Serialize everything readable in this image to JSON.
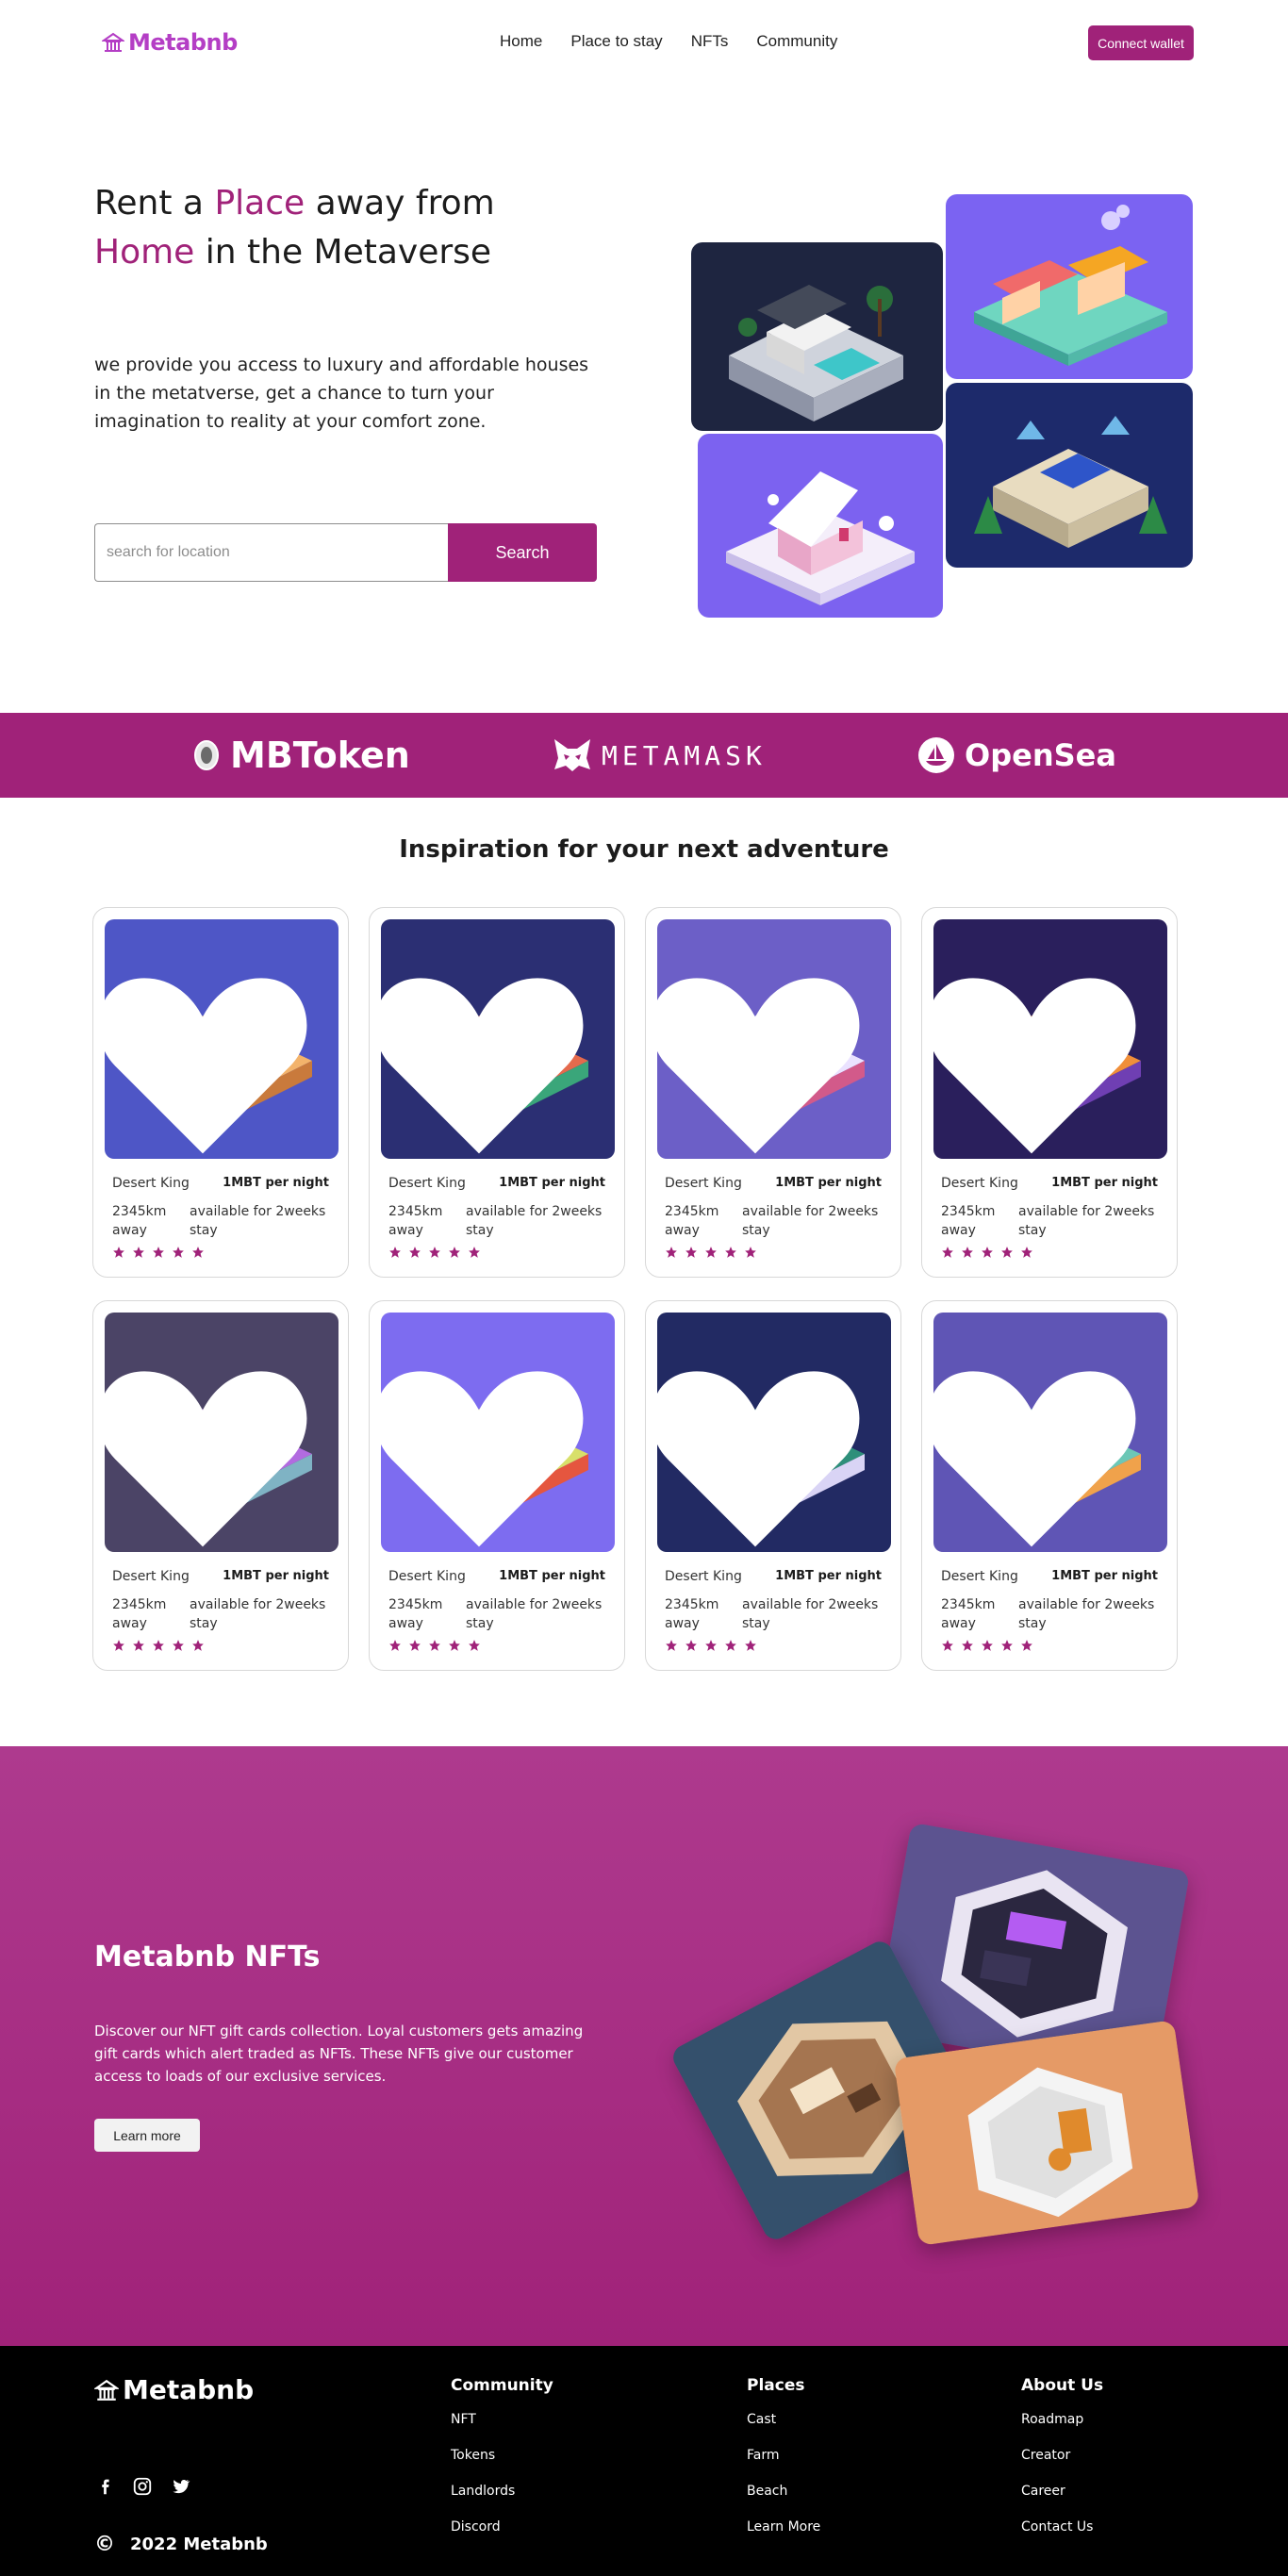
{
  "brand": {
    "name": "Metabnb",
    "logo_icon": "house-icon",
    "accent_color": "#a02279",
    "logo_color": "#b43ec5"
  },
  "nav": {
    "links": [
      "Home",
      "Place to stay",
      "NFTs",
      "Community"
    ],
    "connect_label": "Connect wallet"
  },
  "hero": {
    "title_part1": "Rent a ",
    "title_accent1": "Place",
    "title_part2": " away from",
    "title_accent2": "Home",
    "title_part3": " in the Metaverse",
    "description": "we provide you access to luxury and affordable houses in the metatverse, get a chance to turn your imagination to reality at your comfort zone.",
    "search_placeholder": "search for location",
    "search_value": "",
    "search_button": "Search"
  },
  "partners": [
    {
      "name": "MBToken",
      "icon": "mbtoken-coin-icon"
    },
    {
      "name": "METAMASK",
      "icon": "metamask-fox-icon"
    },
    {
      "name": "OpenSea",
      "icon": "opensea-boat-icon"
    }
  ],
  "inspiration": {
    "title": "Inspiration for your next adventure",
    "cards": [
      {
        "name": "Desert King",
        "price": "1MBT per night",
        "distance": "2345km away",
        "availability": "available for 2weeks stay",
        "rating": 5
      },
      {
        "name": "Desert King",
        "price": "1MBT per night",
        "distance": "2345km away",
        "availability": "available for 2weeks stay",
        "rating": 5
      },
      {
        "name": "Desert King",
        "price": "1MBT per night",
        "distance": "2345km away",
        "availability": "available for 2weeks stay",
        "rating": 5
      },
      {
        "name": "Desert King",
        "price": "1MBT per night",
        "distance": "2345km away",
        "availability": "available for 2weeks stay",
        "rating": 5
      },
      {
        "name": "Desert King",
        "price": "1MBT per night",
        "distance": "2345km away",
        "availability": "available for 2weeks stay",
        "rating": 5
      },
      {
        "name": "Desert King",
        "price": "1MBT per night",
        "distance": "2345km away",
        "availability": "available for 2weeks stay",
        "rating": 5
      },
      {
        "name": "Desert King",
        "price": "1MBT per night",
        "distance": "2345km away",
        "availability": "available for 2weeks stay",
        "rating": 5
      },
      {
        "name": "Desert King",
        "price": "1MBT per night",
        "distance": "2345km away",
        "availability": "available for 2weeks stay",
        "rating": 5
      }
    ]
  },
  "nfts": {
    "title": "Metabnb NFTs",
    "description": "Discover our NFT gift cards collection. Loyal customers gets amazing gift cards which alert traded as NFTs. These NFTs give our customer access to loads of our exclusive services.",
    "button": "Learn more"
  },
  "footer": {
    "brand": "Metabnb",
    "columns": [
      {
        "title": "Community",
        "links": [
          "NFT",
          "Tokens",
          "Landlords",
          "Discord"
        ]
      },
      {
        "title": "Places",
        "links": [
          "Cast",
          "Farm",
          "Beach",
          "Learn More"
        ]
      },
      {
        "title": "About Us",
        "links": [
          "Roadmap",
          "Creator",
          "Career",
          "Contact Us"
        ]
      }
    ],
    "socials": [
      "facebook-icon",
      "instagram-icon",
      "twitter-icon"
    ],
    "copyright_symbol": "©",
    "copyright": "2022 Metabnb"
  }
}
